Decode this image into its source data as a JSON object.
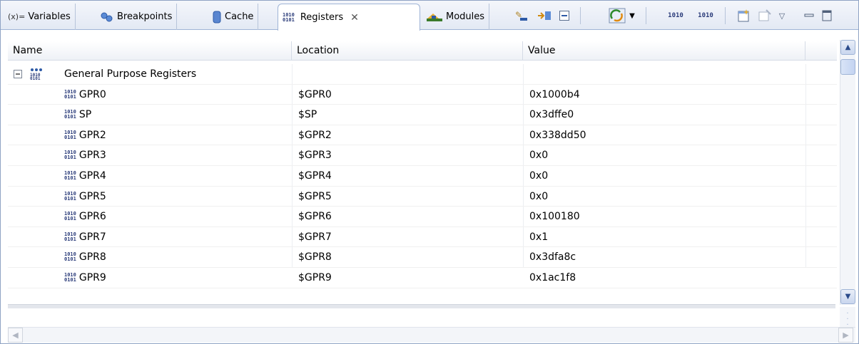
{
  "tabs": [
    {
      "label": "Variables",
      "icon": "variables-icon"
    },
    {
      "label": "Breakpoints",
      "icon": "breakpoints-icon"
    },
    {
      "label": "Cache",
      "icon": "cache-icon"
    },
    {
      "label": "Registers",
      "icon": "registers-icon",
      "active": true
    },
    {
      "label": "Modules",
      "icon": "modules-icon"
    }
  ],
  "tab_prefix": {
    "variables": "(x)="
  },
  "columns": [
    "Name",
    "Location",
    "Value"
  ],
  "group": {
    "label": "General Purpose Registers",
    "expanded": true
  },
  "registers": [
    {
      "name": "GPR0",
      "location": "$GPR0",
      "value": "0x1000b4"
    },
    {
      "name": "SP",
      "location": "$SP",
      "value": "0x3dffe0"
    },
    {
      "name": "GPR2",
      "location": "$GPR2",
      "value": "0x338dd50"
    },
    {
      "name": "GPR3",
      "location": "$GPR3",
      "value": "0x0"
    },
    {
      "name": "GPR4",
      "location": "$GPR4",
      "value": "0x0"
    },
    {
      "name": "GPR5",
      "location": "$GPR5",
      "value": "0x0"
    },
    {
      "name": "GPR6",
      "location": "$GPR6",
      "value": "0x100180"
    },
    {
      "name": "GPR7",
      "location": "$GPR7",
      "value": "0x1"
    },
    {
      "name": "GPR8",
      "location": "$GPR8",
      "value": "0x3dfa8c"
    },
    {
      "name": "GPR9",
      "location": "$GPR9",
      "value": "0x1ac1f8"
    }
  ],
  "toolbar": {
    "bits_a": "1010",
    "bits_b": "1010",
    "icons": [
      "add-register-group-icon",
      "edit-register-group-icon",
      "collapse-all-icon",
      "number-format-icon",
      "dropdown-icon",
      "previous-register-icon",
      "next-register-icon",
      "new-view-icon",
      "pin-icon",
      "view-menu-icon",
      "minimize-icon",
      "maximize-icon"
    ]
  },
  "colors": {
    "accent": "#2b3c7a",
    "tab_border": "#9fb4d6"
  }
}
